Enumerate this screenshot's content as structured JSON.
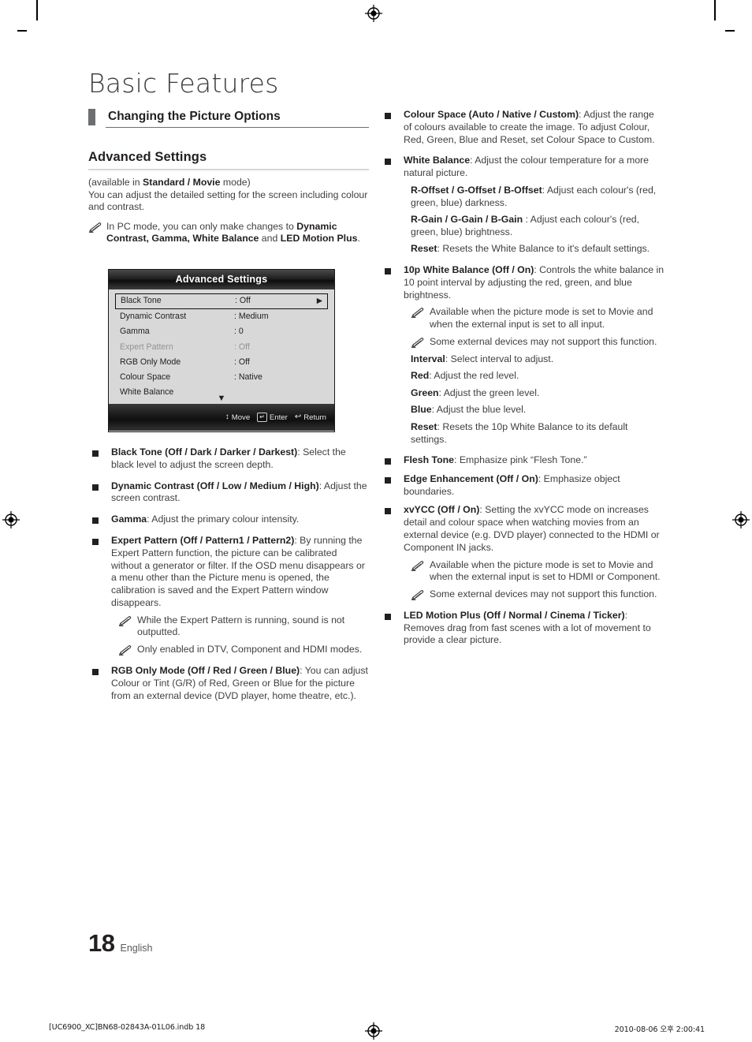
{
  "document": {
    "chapter_title": "Basic Features",
    "section_header": "Changing the Picture Options",
    "page_number": "18",
    "page_language": "English",
    "indicia": "[UC6900_XC]BN68-02843A-01L06.indb   18",
    "timestamp": "2010-08-06   오후 2:00:41"
  },
  "left_column": {
    "sub_head": "Advanced Settings",
    "intro_line1_pre": "(available in ",
    "intro_line1_bold": "Standard / Movie",
    "intro_line1_post": " mode)",
    "intro_line2": "You can adjust the detailed setting for the screen including colour and contrast.",
    "note1_pre": "In PC mode, you can only make changes to ",
    "note1_bold1": "Dynamic Contrast, Gamma, White Balance",
    "note1_mid": " and ",
    "note1_bold2": "LED Motion Plus",
    "note1_post": ".",
    "bullets": [
      {
        "title": "Black Tone (Off / Dark / Darker / Darkest)",
        "body": ": Select the black level to adjust the screen depth."
      },
      {
        "title": "Dynamic Contrast (Off / Low / Medium / High)",
        "body": ": Adjust the screen contrast."
      },
      {
        "title": "Gamma",
        "body": ": Adjust the primary colour intensity."
      },
      {
        "title": "Expert Pattern (Off / Pattern1 / Pattern2)",
        "body": ": By running the Expert Pattern function, the picture can be calibrated without a generator or filter. If the OSD menu disappears or a menu other than the Picture menu is opened, the calibration is saved and the Expert Pattern window disappears.",
        "notes": [
          "While the Expert Pattern is running, sound is not outputted.",
          "Only enabled in DTV, Component and HDMI modes."
        ]
      },
      {
        "title": "RGB Only Mode (Off / Red / Green / Blue)",
        "body": ": You can adjust Colour or Tint (G/R) of Red, Green or Blue for the picture from an external device (DVD player, home theatre, etc.)."
      }
    ]
  },
  "osd": {
    "title": "Advanced Settings",
    "rows": [
      {
        "label": "Black Tone",
        "value": ": Off",
        "selected": true,
        "dim": false,
        "arrow": "▶"
      },
      {
        "label": "Dynamic Contrast",
        "value": ": Medium",
        "selected": false,
        "dim": false,
        "arrow": ""
      },
      {
        "label": "Gamma",
        "value": ": 0",
        "selected": false,
        "dim": false,
        "arrow": ""
      },
      {
        "label": "Expert Pattern",
        "value": ": Off",
        "selected": false,
        "dim": true,
        "arrow": ""
      },
      {
        "label": "RGB Only Mode",
        "value": ": Off",
        "selected": false,
        "dim": false,
        "arrow": ""
      },
      {
        "label": "Colour Space",
        "value": ": Native",
        "selected": false,
        "dim": false,
        "arrow": ""
      },
      {
        "label": "White Balance",
        "value": "",
        "selected": false,
        "dim": false,
        "arrow": ""
      }
    ],
    "scroll_indicator": "▼",
    "footer": {
      "move_glyph": "↕",
      "move_label": "Move",
      "enter_glyph": "↵",
      "enter_label": "Enter",
      "return_glyph": "↩",
      "return_label": "Return"
    }
  },
  "right_column": {
    "bullets": [
      {
        "title": "Colour Space (Auto / Native / Custom)",
        "body": ": Adjust the range of colours available to create the image. To adjust Colour, Red, Green, Blue and Reset, set Colour Space to Custom."
      },
      {
        "title": "White Balance",
        "body": ": Adjust the colour temperature for a more natural picture.",
        "defs": [
          {
            "term": "R-Offset / G-Offset / B-Offset",
            "text": ": Adjust each colour's (red, green, blue) darkness."
          },
          {
            "term": "R-Gain / G-Gain / B-Gain",
            "text": " : Adjust each colour's (red, green, blue) brightness."
          },
          {
            "term": "Reset",
            "text": ": Resets the White Balance to it's default settings."
          }
        ]
      },
      {
        "title": "10p White Balance (Off / On)",
        "body": ": Controls the white balance in 10 point interval by adjusting the red, green, and blue brightness.",
        "notes": [
          "Available when the picture mode is set to Movie and when the external input is set to all input.",
          "Some external devices may not support this function."
        ],
        "defs": [
          {
            "term": "Interval",
            "text": ": Select interval to adjust."
          },
          {
            "term": "Red",
            "text": ": Adjust the red level."
          },
          {
            "term": "Green",
            "text": ": Adjust the green level."
          },
          {
            "term": "Blue",
            "text": ": Adjust the blue level."
          },
          {
            "term": "Reset",
            "text": ": Resets the 10p White Balance to its default settings."
          }
        ]
      },
      {
        "title": "Flesh Tone",
        "body": ": Emphasize pink “Flesh Tone.”"
      },
      {
        "title": "Edge Enhancement (Off / On)",
        "body": ": Emphasize object boundaries."
      },
      {
        "title": "xvYCC (Off / On)",
        "body": ": Setting the xvYCC mode on increases detail and colour space when watching movies from an external device (e.g. DVD player) connected to the HDMI or Component IN jacks.",
        "notes": [
          "Available when the picture mode is set to Movie and when the external input is set to HDMI or Component.",
          "Some external devices may not support this function."
        ]
      },
      {
        "title": "LED Motion Plus (Off / Normal / Cinema / Ticker)",
        "body": ": Removes drag from fast scenes with a lot of movement to provide a clear picture."
      }
    ]
  },
  "colors": {
    "text": "#404041",
    "heading": "#231f20",
    "section_bar": "#6d6e70",
    "rule": "#d7d7d9",
    "osd_body": "#d8d8d8",
    "osd_dim": "#949494"
  }
}
